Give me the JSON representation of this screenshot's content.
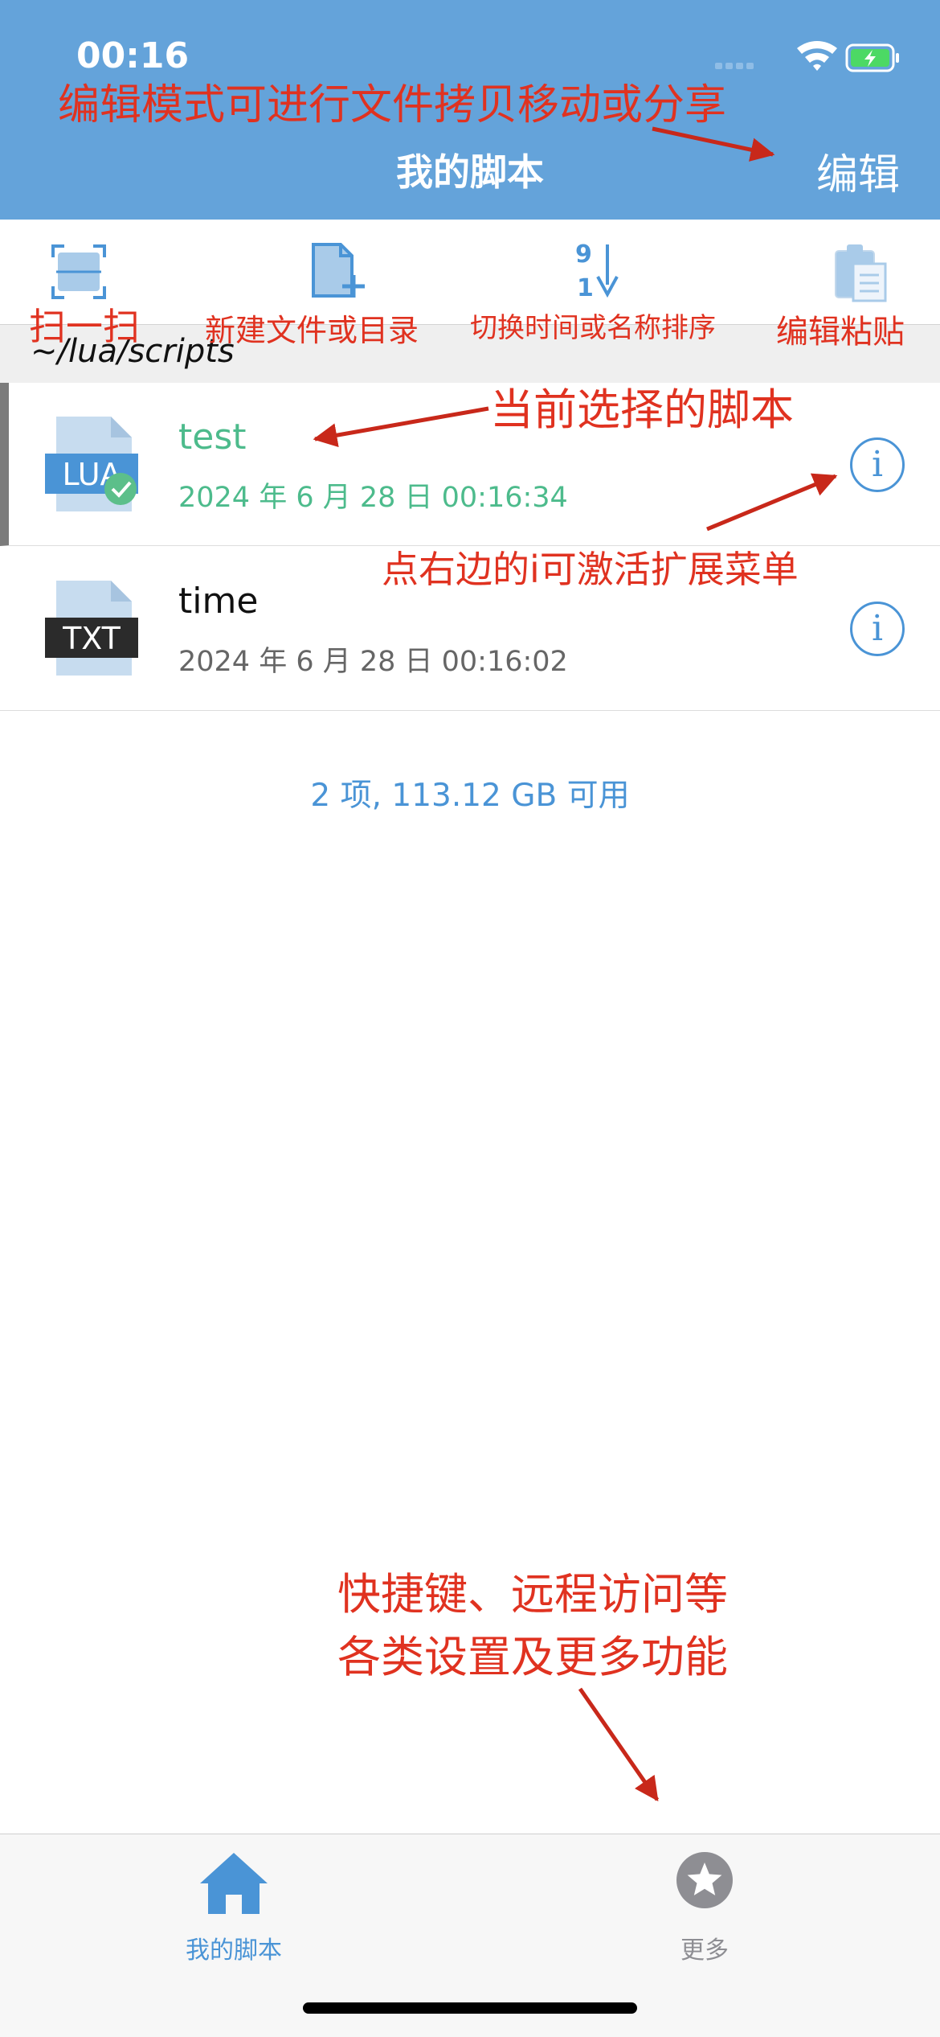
{
  "status_bar": {
    "time": "00:16"
  },
  "nav": {
    "title": "我的脚本",
    "edit_label": "编辑"
  },
  "path": "~/lua/scripts",
  "files": [
    {
      "name": "test",
      "date": "2024 年 6 月 28 日 00:16:34",
      "icon_text": "LUA",
      "selected": true
    },
    {
      "name": "time",
      "date": "2024 年 6 月 28 日 00:16:02",
      "icon_text": "TXT",
      "selected": false
    }
  ],
  "summary": "2 项, 113.12 GB 可用",
  "tabs": [
    {
      "label": "我的脚本",
      "icon": "home-icon",
      "active": true
    },
    {
      "label": "更多",
      "icon": "star-icon",
      "active": false
    }
  ],
  "annotations": {
    "edit_mode": "编辑模式可进行文件拷贝移动或分享",
    "scan": "扫一扫",
    "new_file": "新建文件或目录",
    "sort": "切换时间或名称排序",
    "paste": "编辑粘贴",
    "current_script": "当前选择的脚本",
    "info_hint": "点右边的i可激活扩展菜单",
    "more_line1": "快捷键、远程访问等",
    "more_line2": "各类设置及更多功能"
  },
  "colors": {
    "nav_background": "#64a3da",
    "accent_blue": "#4a94d6",
    "selected_green": "#4dbb8c",
    "annotation_red": "#e03220"
  }
}
